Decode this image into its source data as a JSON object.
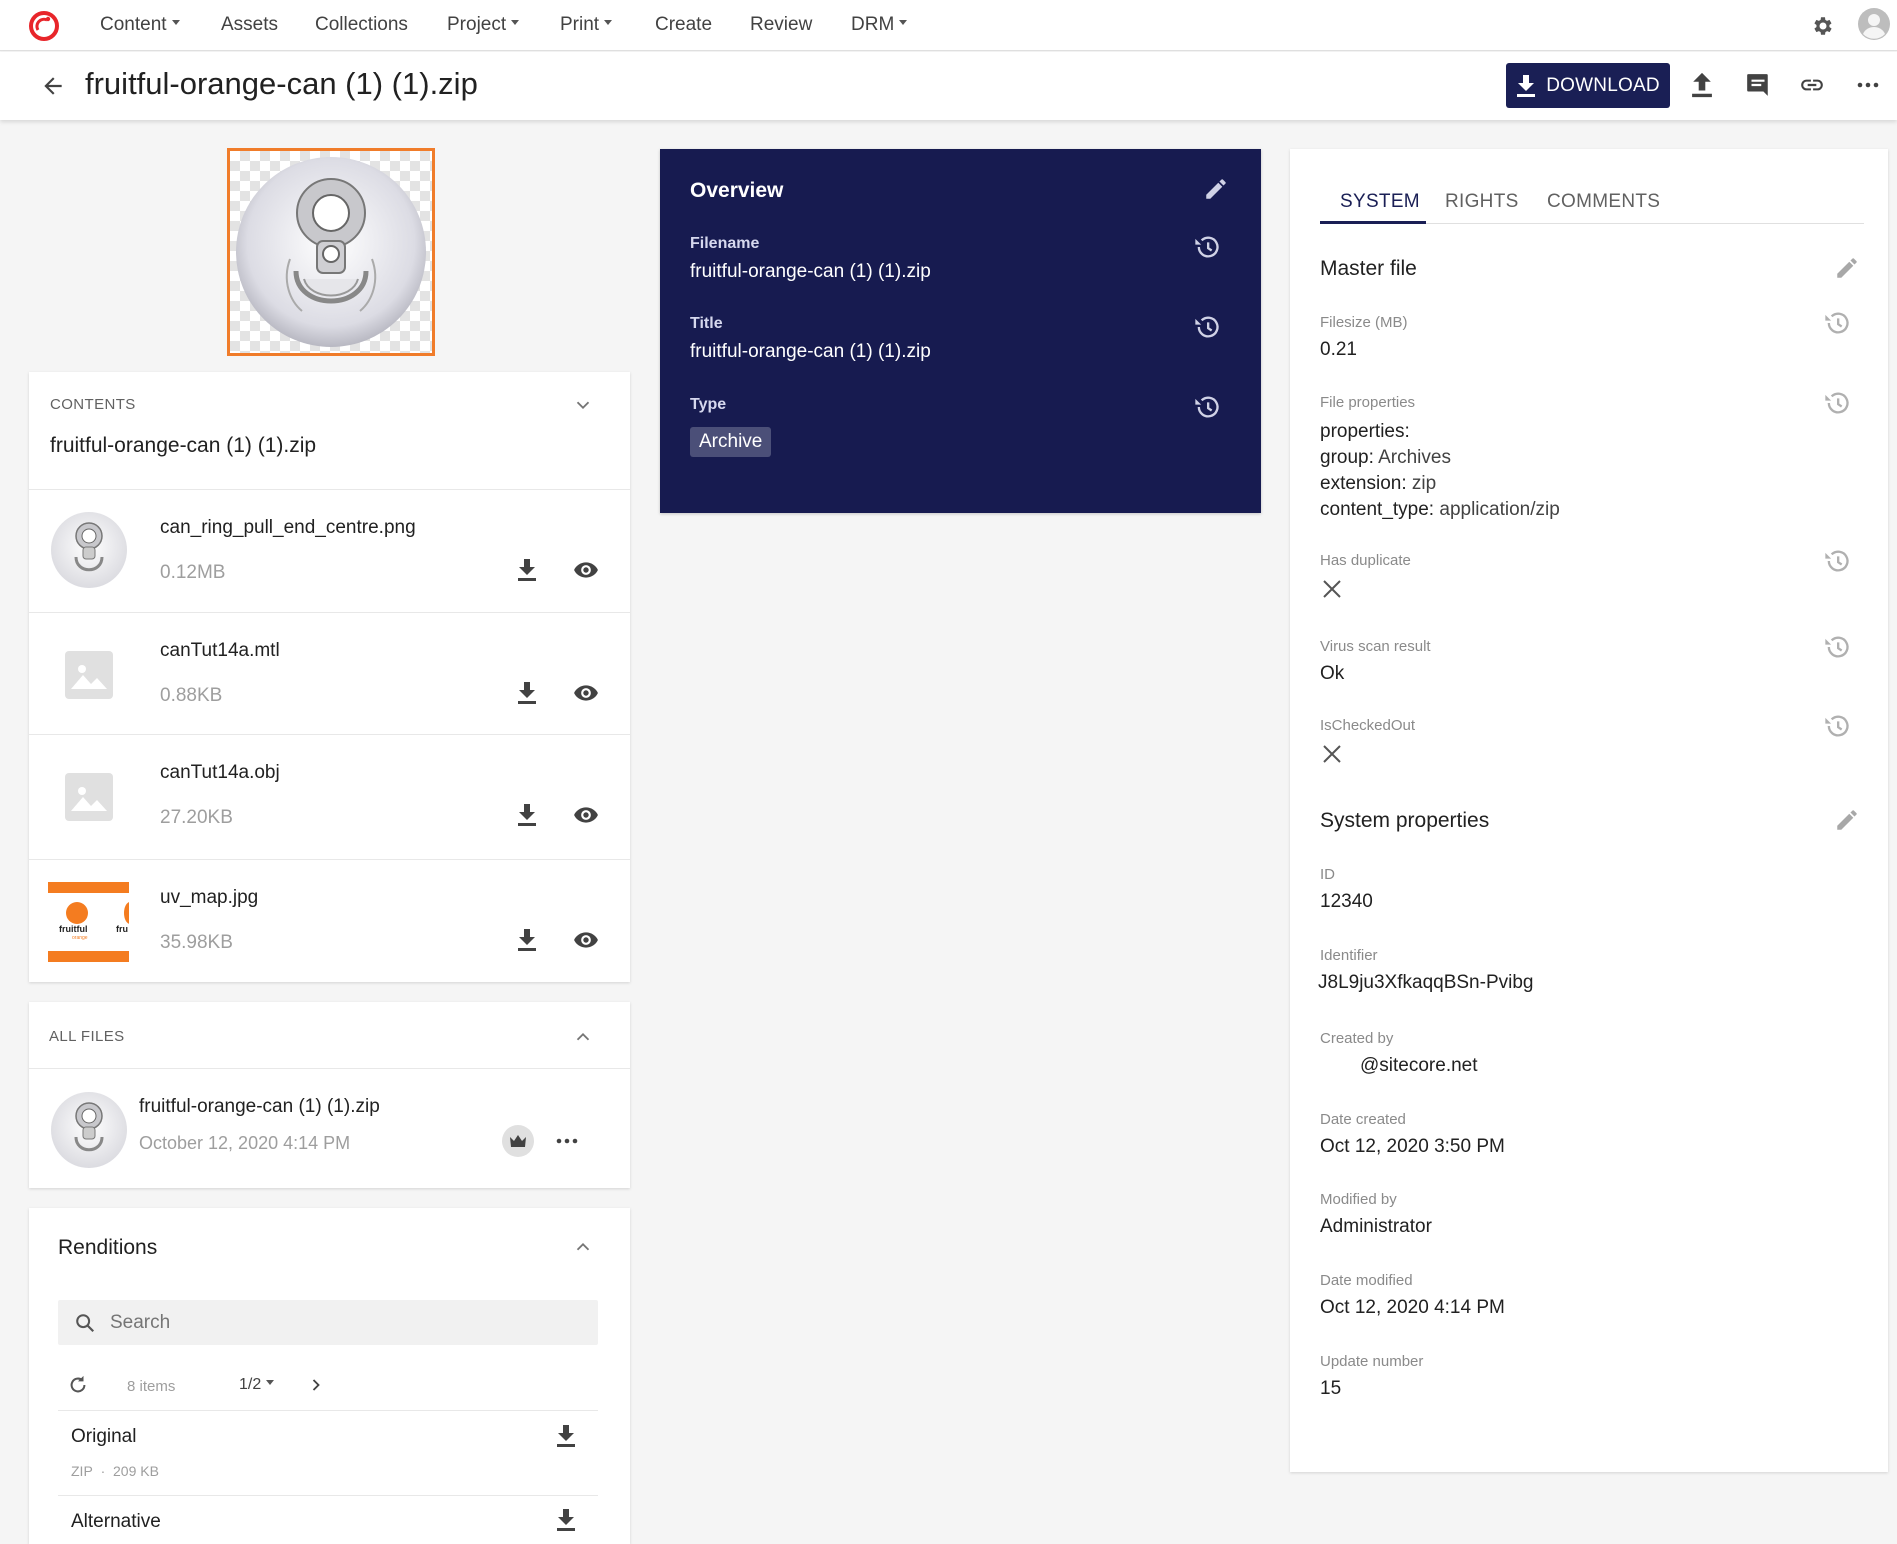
{
  "nav": {
    "items": [
      {
        "label": "Content",
        "dropdown": true
      },
      {
        "label": "Assets",
        "dropdown": false
      },
      {
        "label": "Collections",
        "dropdown": false
      },
      {
        "label": "Project",
        "dropdown": true
      },
      {
        "label": "Print",
        "dropdown": true
      },
      {
        "label": "Create",
        "dropdown": false
      },
      {
        "label": "Review",
        "dropdown": false
      },
      {
        "label": "DRM",
        "dropdown": true
      }
    ],
    "icons": {
      "settings": "gear-icon",
      "user": "account-circle-icon"
    }
  },
  "header": {
    "title": "fruitful-orange-can (1) (1).zip",
    "download_label": "DOWNLOAD"
  },
  "contents": {
    "heading": "CONTENTS",
    "archive_name": "fruitful-orange-can (1) (1).zip",
    "files": [
      {
        "name": "can_ring_pull_end_centre.png",
        "size": "0.12MB"
      },
      {
        "name": "canTut14a.mtl",
        "size": "0.88KB"
      },
      {
        "name": "canTut14a.obj",
        "size": "27.20KB"
      },
      {
        "name": "uv_map.jpg",
        "size": "35.98KB"
      }
    ],
    "uv_thumb_text": {
      "brand": "fruitful",
      "brand_sub": "orange",
      "brand_cut": "fru"
    }
  },
  "all_files": {
    "heading": "ALL FILES",
    "file": {
      "name": "fruitful-orange-can (1) (1).zip",
      "date": "October 12, 2020 4:14 PM"
    }
  },
  "renditions": {
    "title": "Renditions",
    "search_placeholder": "Search",
    "count": "8 items",
    "page": "1/2",
    "items": [
      {
        "name": "Original",
        "type": "ZIP",
        "sep": "·",
        "size": "209 KB"
      },
      {
        "name": "Alternative"
      }
    ]
  },
  "overview": {
    "title": "Overview",
    "filename_label": "Filename",
    "filename_value": "fruitful-orange-can (1) (1).zip",
    "title_label": "Title",
    "title_value": "fruitful-orange-can (1) (1).zip",
    "type_label": "Type",
    "type_value": "Archive"
  },
  "right_panel": {
    "tabs": [
      "SYSTEM",
      "RIGHTS",
      "COMMENTS"
    ],
    "active_tab": "SYSTEM",
    "master_file": {
      "title": "Master file",
      "filesize_label": "Filesize (MB)",
      "filesize_value": "0.21",
      "file_properties_label": "File properties",
      "props_heading": "properties:",
      "group_key": "group:",
      "group_val": "Archives",
      "extension_key": "extension:",
      "extension_val": "zip",
      "content_type_key": "content_type:",
      "content_type_val": "application/zip",
      "has_duplicate_label": "Has duplicate",
      "virus_scan_label": "Virus scan result",
      "virus_scan_value": "Ok",
      "checked_out_label": "IsCheckedOut"
    },
    "system_properties": {
      "title": "System properties",
      "id_label": "ID",
      "id_value": "12340",
      "identifier_label": "Identifier",
      "identifier_value": "J8L9ju3XfkaqqBSn-Pvibg",
      "created_by_label": "Created by",
      "created_by_value": "@sitecore.net",
      "date_created_label": "Date created",
      "date_created_value": "Oct 12, 2020 3:50 PM",
      "modified_by_label": "Modified by",
      "modified_by_value": "Administrator",
      "date_modified_label": "Date modified",
      "date_modified_value": "Oct 12, 2020 4:14 PM",
      "update_number_label": "Update number",
      "update_number_value": "15"
    }
  },
  "colors": {
    "accent": "#1a1f55",
    "overview_bg": "#171b50",
    "thumb_border": "#f07c2a",
    "logo": "#e8252a"
  }
}
